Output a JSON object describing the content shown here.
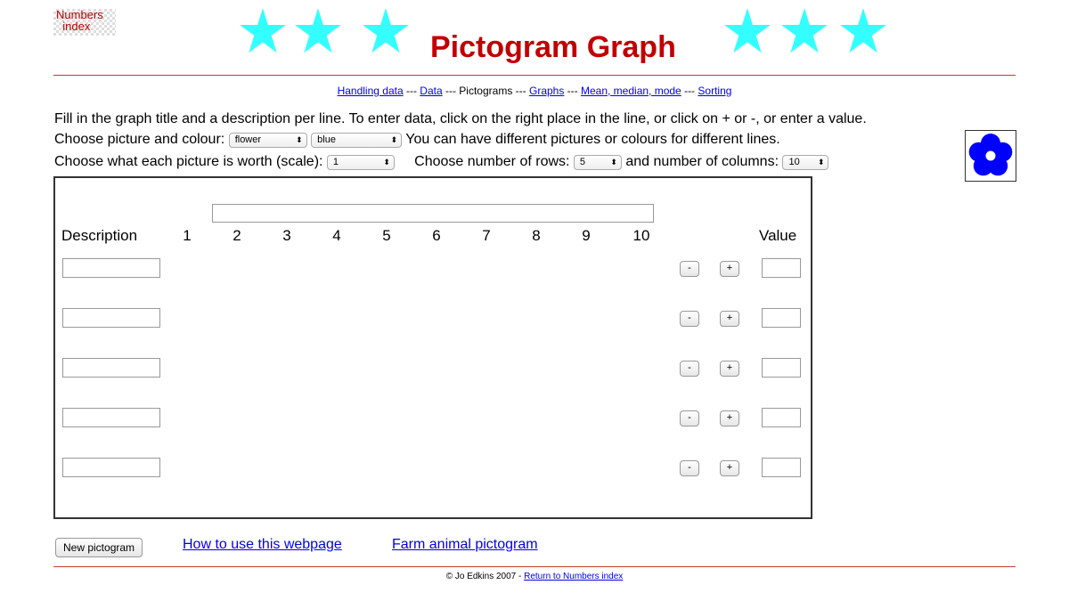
{
  "logo": {
    "line1": "Numbers",
    "line2": "index"
  },
  "header": {
    "title": "Pictogram Graph",
    "star_color": "#33ffff",
    "title_color": "#c00000"
  },
  "nav": {
    "links": [
      "Handling data",
      "Data",
      "Pictograms",
      "Graphs",
      "Mean, median, mode",
      "Sorting"
    ],
    "separator": " --- "
  },
  "instructions": {
    "line1": "Fill in the graph title and a description per line. To enter data, click on the right place in the line, or click on + or -, or enter a value.",
    "picture_label": "Choose picture and colour:",
    "picture_value": "flower",
    "colour_value": "blue",
    "picture_note": "You can have different pictures or colours for different lines.",
    "scale_label": "Choose what each picture is worth (scale):",
    "scale_value": "1",
    "rows_label": "Choose number of rows:",
    "rows_value": "5",
    "cols_label": "and number of columns:",
    "cols_value": "10"
  },
  "preview": {
    "icon": "flower-icon",
    "color": "#0000ff"
  },
  "graph": {
    "title_value": "",
    "description_header": "Description",
    "value_header": "Value",
    "columns": [
      "1",
      "2",
      "3",
      "4",
      "5",
      "6",
      "7",
      "8",
      "9",
      "10"
    ],
    "rows": [
      {
        "description": "",
        "value": ""
      },
      {
        "description": "",
        "value": ""
      },
      {
        "description": "",
        "value": ""
      },
      {
        "description": "",
        "value": ""
      },
      {
        "description": "",
        "value": ""
      }
    ],
    "minus_label": "-",
    "plus_label": "+"
  },
  "actions": {
    "new_pictogram": "New pictogram",
    "how_to": "How to use this webpage",
    "farm": "Farm animal pictogram"
  },
  "footer": {
    "copyright": "© Jo Edkins 2007 - ",
    "link": "Return to Numbers index"
  }
}
